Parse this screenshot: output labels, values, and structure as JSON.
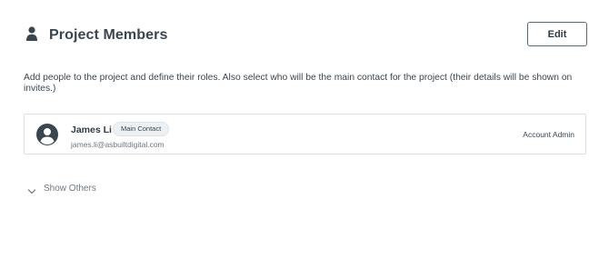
{
  "header": {
    "title": "Project Members",
    "edit_label": "Edit",
    "icon": "user-icon"
  },
  "description": "Add people to the project and define their roles. Also select who will be the main contact for the project (their details will be shown on invites.)",
  "members": [
    {
      "name": "James Li",
      "badge": "Main Contact",
      "email": "james.li@asbuiltdigital.com",
      "role": "Account Admin",
      "avatar_icon": "account-circle-icon"
    }
  ],
  "show_others": {
    "label": "Show Others",
    "icon": "chevron-down-icon"
  },
  "colors": {
    "text": "#2f3a45",
    "muted": "#6d7781",
    "border": "#dcdfe3",
    "badge_bg": "#eef1f4"
  }
}
